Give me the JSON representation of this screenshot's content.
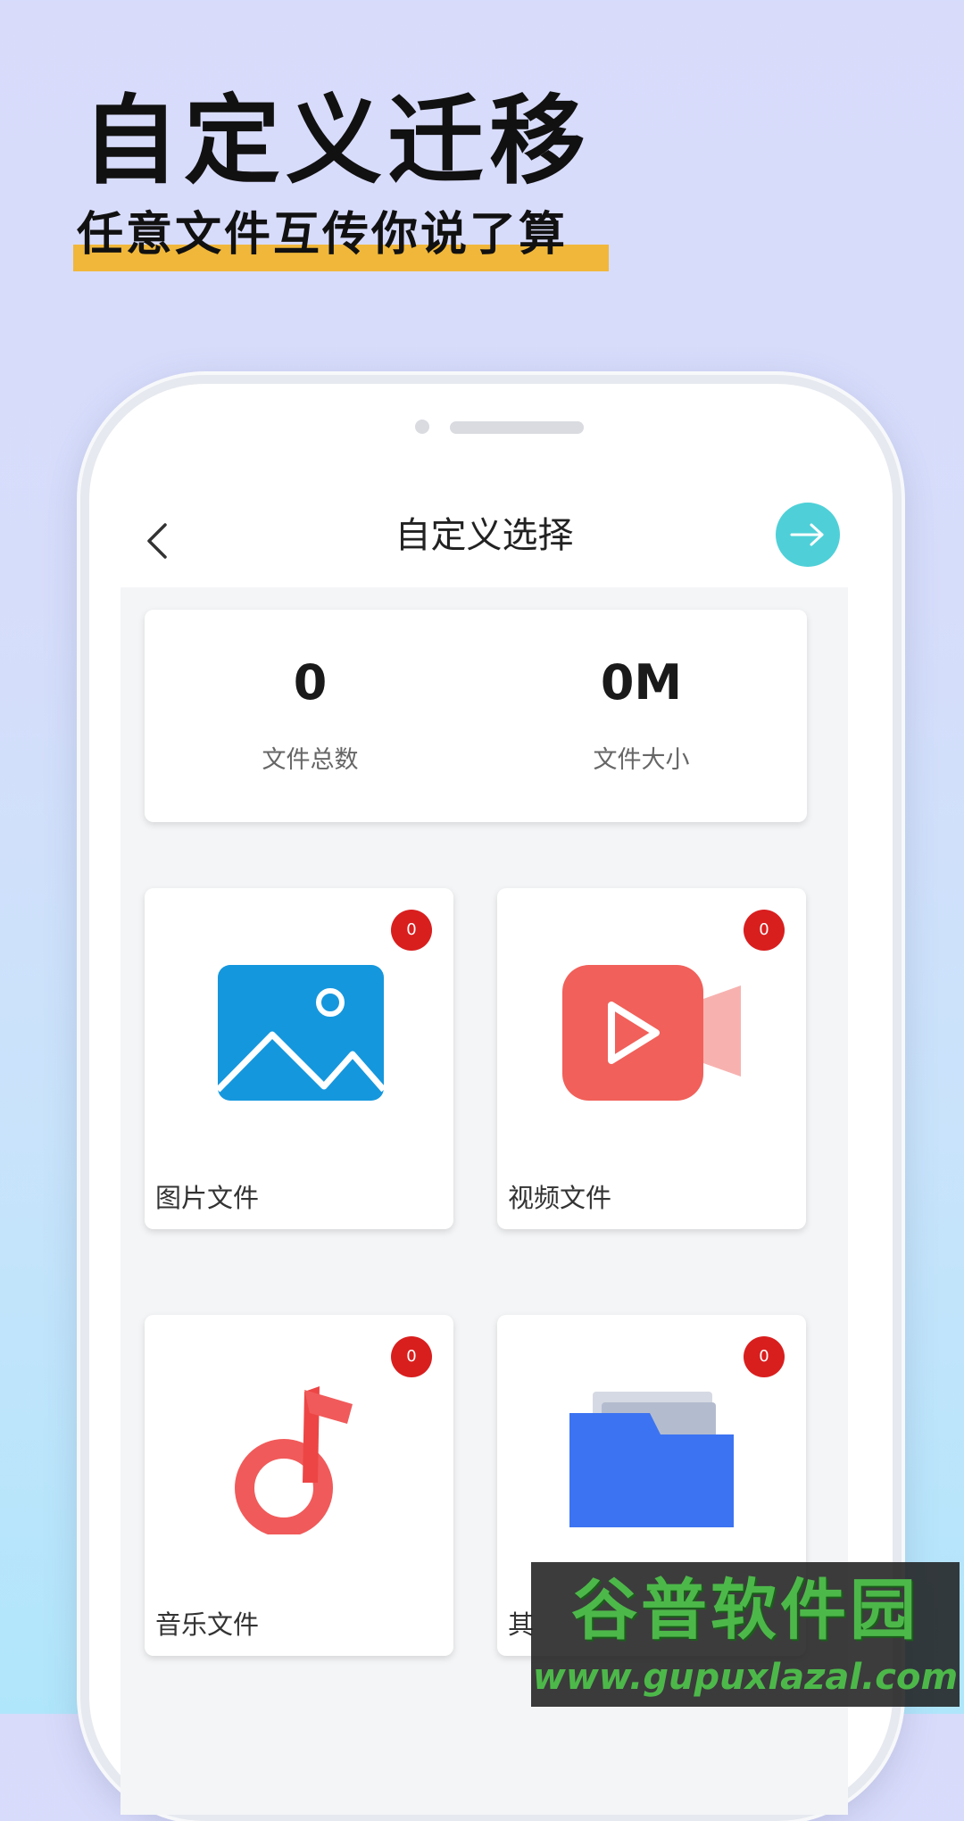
{
  "banner": {
    "headline": "自定义迁移",
    "subline": "任意文件互传你说了算",
    "highlight_color": "#f0b73a"
  },
  "screen": {
    "title": "自定义选择",
    "back_icon": "chevron-left-icon",
    "next_icon": "arrow-right-icon",
    "accent_color": "#4fd0d8",
    "stats": [
      {
        "value": "0",
        "label": "文件总数"
      },
      {
        "value": "0M",
        "label": "文件大小"
      }
    ],
    "categories": [
      {
        "label": "图片文件",
        "count": "0",
        "icon": "image-icon",
        "color": "#1597dd"
      },
      {
        "label": "视频文件",
        "count": "0",
        "icon": "video-icon",
        "color": "#f1605a"
      },
      {
        "label": "音乐文件",
        "count": "0",
        "icon": "music-icon",
        "color": "#f15a5a"
      },
      {
        "label": "其",
        "count": "0",
        "icon": "folder-icon",
        "color": "#3c73f2"
      }
    ],
    "badge_color": "#d91e1e"
  },
  "watermark": {
    "title": "谷普软件园",
    "url": "www.gupuxlazal.com"
  }
}
